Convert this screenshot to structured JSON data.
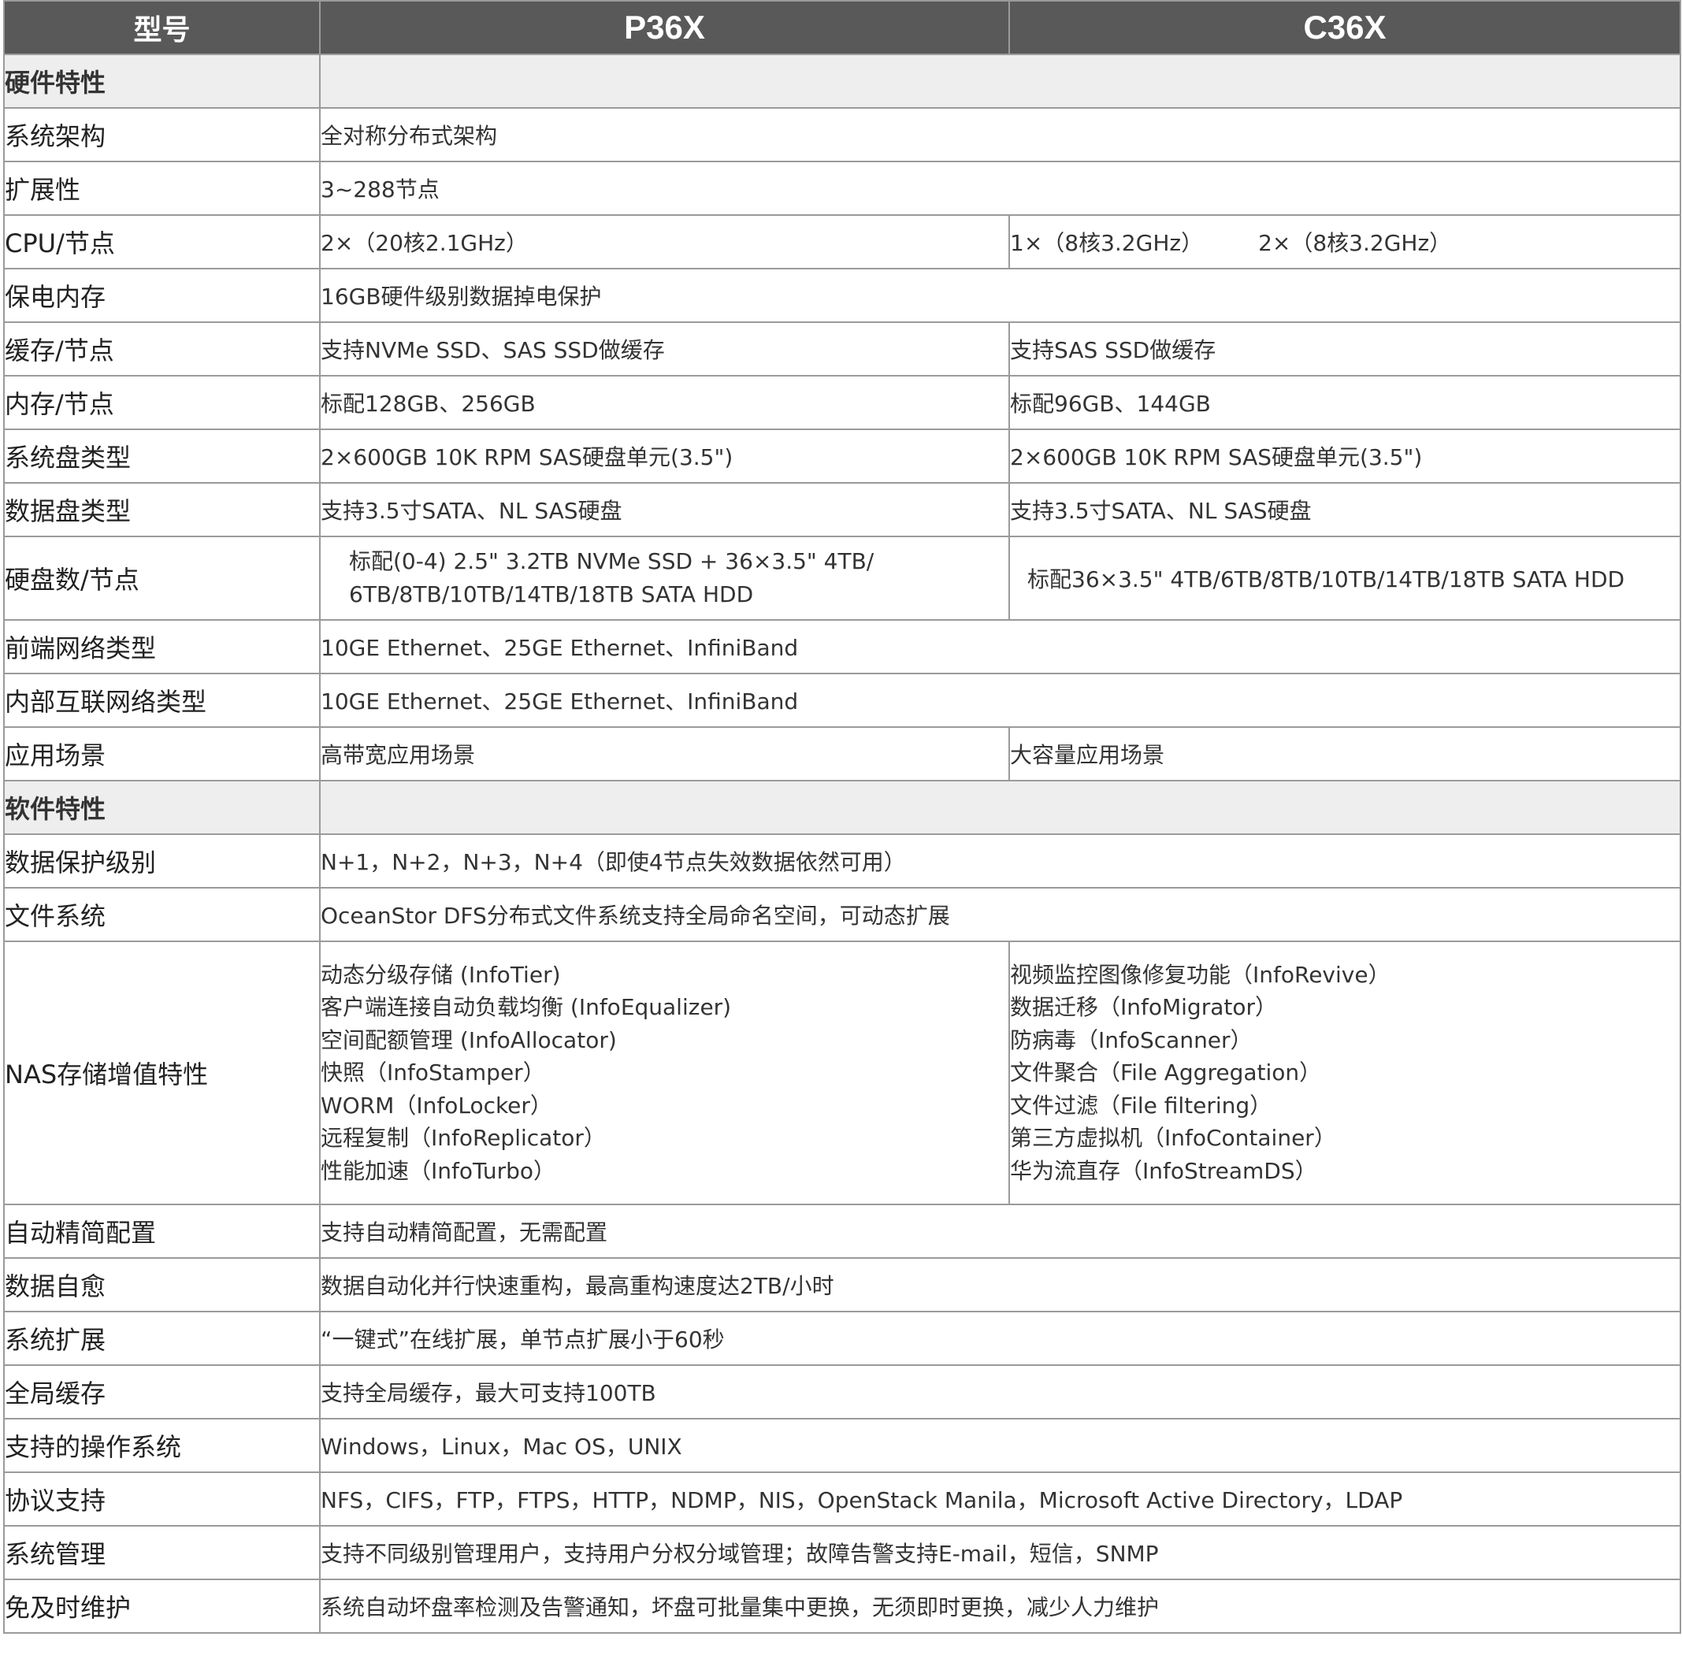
{
  "header": {
    "col_label": "型号",
    "col_a": "P36X",
    "col_b": "C36X"
  },
  "rows": [
    {
      "type": "section",
      "label": "硬件特性"
    },
    {
      "type": "full",
      "label": "系统架构",
      "value": "全对称分布式架构"
    },
    {
      "type": "full",
      "label": "扩展性",
      "value": "3~288节点"
    },
    {
      "type": "split",
      "label": "CPU/节点",
      "a": "2×（20核2.1GHz）",
      "b1": "1×（8核3.2GHz）",
      "b2": "2×（8核3.2GHz）"
    },
    {
      "type": "full",
      "label": "保电内存",
      "value": "16GB硬件级别数据掉电保护"
    },
    {
      "type": "split",
      "label": "缓存/节点",
      "a": "支持NVMe SSD、SAS SSD做缓存",
      "b": "支持SAS SSD做缓存"
    },
    {
      "type": "split",
      "label": "内存/节点",
      "a": "标配128GB、256GB",
      "b": "标配96GB、144GB"
    },
    {
      "type": "split",
      "label": "系统盘类型",
      "a": "2×600GB 10K RPM SAS硬盘单元(3.5\")",
      "b": "2×600GB 10K RPM SAS硬盘单元(3.5\")"
    },
    {
      "type": "split",
      "label": "数据盘类型",
      "a": "支持3.5寸SATA、NL SAS硬盘",
      "b": "支持3.5寸SATA、NL SAS硬盘"
    },
    {
      "type": "split",
      "label": "硬盘数/节点",
      "a_lines": [
        "标配(0-4) 2.5\" 3.2TB NVMe SSD + 36×3.5\" 4TB/",
        "6TB/8TB/10TB/14TB/18TB SATA HDD"
      ],
      "b": "标配36×3.5\" 4TB/6TB/8TB/10TB/14TB/18TB SATA HDD"
    },
    {
      "type": "full",
      "label": "前端网络类型",
      "value": "10GE Ethernet、25GE Ethernet、InfiniBand"
    },
    {
      "type": "full",
      "label": "内部互联网络类型",
      "value": "10GE Ethernet、25GE Ethernet、InfiniBand"
    },
    {
      "type": "split",
      "label": "应用场景",
      "a": "高带宽应用场景",
      "b": "大容量应用场景"
    },
    {
      "type": "section",
      "label": "软件特性"
    },
    {
      "type": "full",
      "label": "数据保护级别",
      "value": "N+1，N+2，N+3，N+4（即使4节点失效数据依然可用）"
    },
    {
      "type": "full",
      "label": "文件系统",
      "value": "OceanStor DFS分布式文件系统支持全局命名空间，可动态扩展"
    },
    {
      "type": "nas",
      "label": "NAS存储增值特性",
      "left": [
        "动态分级存储 (InfoTier)",
        "客户端连接自动负载均衡 (InfoEqualizer)",
        "空间配额管理 (InfoAllocator)",
        "快照（InfoStamper）",
        "WORM（InfoLocker）",
        "远程复制（InfoReplicator）",
        "性能加速（InfoTurbo）"
      ],
      "right": [
        "视频监控图像修复功能（InfoRevive）",
        "数据迁移（InfoMigrator）",
        "防病毒（InfoScanner）",
        "文件聚合（File Aggregation）",
        "文件过滤（File filtering）",
        "第三方虚拟机（InfoContainer）",
        "华为流直存（InfoStreamDS）"
      ]
    },
    {
      "type": "full",
      "label": "自动精简配置",
      "value": "支持自动精简配置，无需配置"
    },
    {
      "type": "full",
      "label": "数据自愈",
      "value": "数据自动化并行快速重构，最高重构速度达2TB/小时"
    },
    {
      "type": "full",
      "label": "系统扩展",
      "value": "“一键式”在线扩展，单节点扩展小于60秒"
    },
    {
      "type": "full",
      "label": "全局缓存",
      "value": "支持全局缓存，最大可支持100TB"
    },
    {
      "type": "full",
      "label": "支持的操作系统",
      "value": "Windows，Linux，Mac OS，UNIX"
    },
    {
      "type": "full",
      "label": "协议支持",
      "value": "NFS，CIFS，FTP，FTPS，HTTP，NDMP，NIS，OpenStack Manila，Microsoft Active Directory，LDAP"
    },
    {
      "type": "full",
      "label": "系统管理",
      "value": "支持不同级别管理用户，支持用户分权分域管理；故障告警支持E-mail，短信，SNMP"
    },
    {
      "type": "full",
      "label": "免及时维护",
      "value": "系统自动坏盘率检测及告警通知，坏盘可批量集中更换，无须即时更换，减少人力维护"
    }
  ]
}
